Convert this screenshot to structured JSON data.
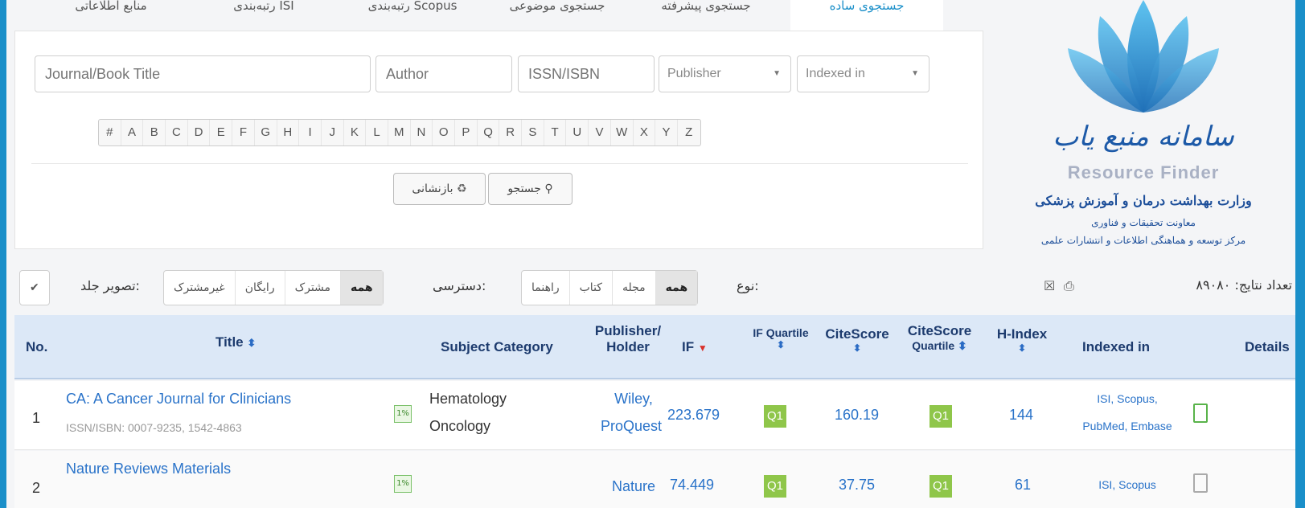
{
  "tabs": [
    "جستجوی ساده",
    "جستجوی پیشرفته",
    "جستجوی موضوعی",
    "رتبه‌بندی Scopus",
    "رتبه‌بندی ISI",
    "منابع اطلاعاتی"
  ],
  "search": {
    "title_placeholder": "Journal/Book Title",
    "author_placeholder": "Author",
    "issn_placeholder": "ISSN/ISBN",
    "publisher_label": "Publisher",
    "indexed_label": "Indexed in",
    "letters": [
      "#",
      "A",
      "B",
      "C",
      "D",
      "E",
      "F",
      "G",
      "H",
      "I",
      "J",
      "K",
      "L",
      "M",
      "N",
      "O",
      "P",
      "Q",
      "R",
      "S",
      "T",
      "U",
      "V",
      "W",
      "X",
      "Y",
      "Z"
    ],
    "search_btn": "جستجو",
    "reset_btn": "بازنشانی"
  },
  "logo": {
    "name_fa": "سامانه منبع یاب",
    "name_en": "Resource Finder",
    "ministry": "وزارت بهداشت درمان و آموزش پزشکی",
    "deputy": "معاونت تحقیقات و فناوری",
    "center": "مرکز توسعه و هماهنگی اطلاعات و انتشارات علمی"
  },
  "filters": {
    "result_label": "تعداد نتایج:",
    "result_count": "۸۹۰۸۰",
    "type_label": "نوع:",
    "type_options": [
      "همه",
      "مجله",
      "کتاب",
      "راهنما"
    ],
    "access_label": "دسترسی:",
    "access_options": [
      "همه",
      "مشترک",
      "رایگان",
      "غیرمشترک"
    ],
    "cover_label": "تصویر جلد:",
    "cover_value": "✔"
  },
  "table": {
    "headers": {
      "no": "No.",
      "title": "Title",
      "subject": "Subject Category",
      "publisher_1": "Publisher/",
      "publisher_2": "Holder",
      "if": "IF",
      "ifq": "IF Quartile",
      "citescore": "CiteScore",
      "csq_1": "CiteScore",
      "csq_2": "Quartile",
      "hindex": "H-Index",
      "indexed": "Indexed in",
      "details": "Details"
    },
    "rows": [
      {
        "no": "1",
        "title": "CA: A Cancer Journal for Clinicians",
        "issn": "ISSN/ISBN: 0007-9235, 1542-4863",
        "pct": "1%",
        "subject_1": "Hematology",
        "subject_2": "Oncology",
        "publisher_1": "Wiley,",
        "publisher_2": "ProQuest",
        "if": "223.679",
        "ifq": "Q1",
        "citescore": "160.19",
        "csq": "Q1",
        "hindex": "144",
        "indexed_1": "ISI, Scopus,",
        "indexed_2": "PubMed, Embase"
      },
      {
        "no": "2",
        "title": "Nature Reviews Materials",
        "pct": "1%",
        "publisher_1": "Nature",
        "if": "74.449",
        "ifq": "Q1",
        "citescore": "37.75",
        "csq": "Q1",
        "hindex": "61",
        "indexed_1": "ISI, Scopus"
      }
    ]
  },
  "colors": {
    "frame_border": "#1a8fc9",
    "accent": "#2a73c9",
    "header_bg": "#dce8f7",
    "quartile_green": "#8fc64a",
    "underline_red": "#c0504d"
  }
}
